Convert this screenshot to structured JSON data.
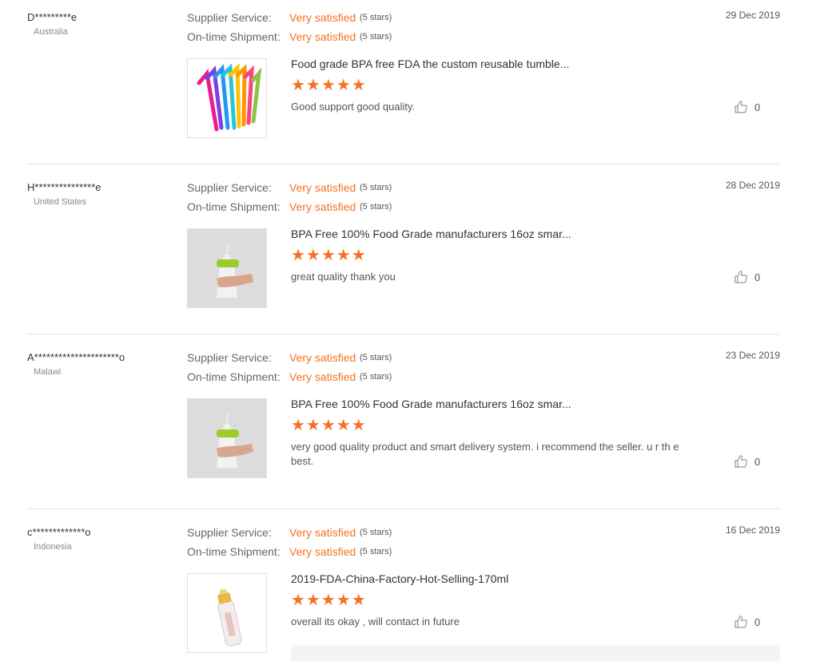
{
  "labels": {
    "supplier_service": "Supplier Service:",
    "ontime_shipment": "On-time Shipment:"
  },
  "colors": {
    "accent": "#f57224",
    "divider": "#e4e4e4"
  },
  "reviews": [
    {
      "buyer": "D*********e",
      "country": "Australia",
      "date": "29 Dec 2019",
      "supplier_service": {
        "value": "Very satisfied",
        "stars_text": "(5 stars)"
      },
      "ontime_shipment": {
        "value": "Very satisfied",
        "stars_text": "(5 stars)"
      },
      "product_title": "Food grade BPA free FDA the custom reusable tumble...",
      "product_image": "colorful-silicone-straws",
      "rating": 5,
      "stars": "★★★★★",
      "comment": "Good support good quality.",
      "likes": "0"
    },
    {
      "buyer": "H***************e",
      "country": "United States",
      "date": "28 Dec 2019",
      "supplier_service": {
        "value": "Very satisfied",
        "stars_text": "(5 stars)"
      },
      "ontime_shipment": {
        "value": "Very satisfied",
        "stars_text": "(5 stars)"
      },
      "product_title": "BPA Free 100% Food Grade manufacturers 16oz smar...",
      "product_image": "silicone-baby-bottle-green",
      "rating": 5,
      "stars": "★★★★★",
      "comment": "great quality thank you",
      "likes": "0"
    },
    {
      "buyer": "A*********************o",
      "country": "Malawi",
      "date": "23 Dec 2019",
      "supplier_service": {
        "value": "Very satisfied",
        "stars_text": "(5 stars)"
      },
      "ontime_shipment": {
        "value": "Very satisfied",
        "stars_text": "(5 stars)"
      },
      "product_title": "BPA Free 100% Food Grade manufacturers 16oz smar...",
      "product_image": "silicone-baby-bottle-green",
      "rating": 5,
      "stars": "★★★★★",
      "comment": "very good quality product and smart delivery system. i recommend the seller. u r th e best.",
      "likes": "0"
    },
    {
      "buyer": "c*************o",
      "country": "Indonesia",
      "date": "16 Dec 2019",
      "supplier_service": {
        "value": "Very satisfied",
        "stars_text": "(5 stars)"
      },
      "ontime_shipment": {
        "value": "Very satisfied",
        "stars_text": "(5 stars)"
      },
      "product_title": "2019-FDA-China-Factory-Hot-Selling-170ml",
      "product_image": "glass-baby-bottle-yellow",
      "rating": 5,
      "stars": "★★★★★",
      "comment": "overall its okay , will contact in future",
      "likes": "0"
    }
  ]
}
